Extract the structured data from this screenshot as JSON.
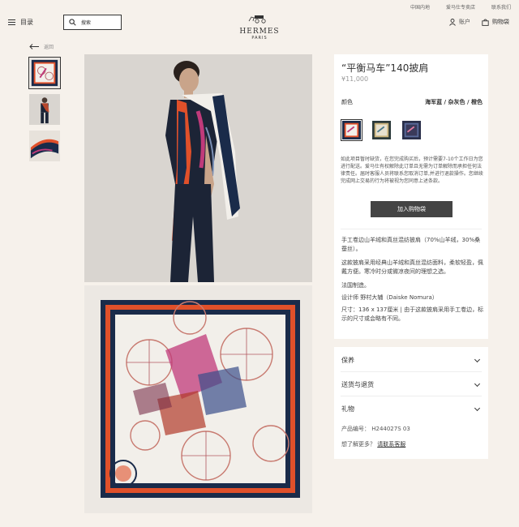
{
  "topbar": {
    "region": "中国内地",
    "service": "爱马仕专卖店",
    "contact": "联系我们"
  },
  "header": {
    "menu_label": "目录",
    "search_placeholder": "搜索",
    "logo_brand": "HERMES",
    "logo_city": "PARIS",
    "account_label": "账户",
    "bag_label": "购物袋"
  },
  "back_label": "返回",
  "product": {
    "title": "“平衡马车”140披肩",
    "price": "¥11,000",
    "color_label": "颜色",
    "color_value": "海军蓝 / 杂灰色 / 橙色",
    "notice": "如此项目暂时缺货，在您完成购买后，预计需要7-10个工作日为您进行配送。爱马仕有权解除此订单且无需为订单解除而承担任何法律责任。届时客服人员将联系您取消订单,并进行退款操作。您继续完成网上交易的行为将被视为您同意上述条款。",
    "add_to_bag": "加入购物袋",
    "desc": [
      "手工卷边山羊绒和真丝混纺披肩（70%山羊绒，30%桑蚕丝）。",
      "这款披肩采用经典山羊绒和真丝混纺面料，柔软轻盈，佩戴方便。寒冷时分或微凉夜间的理想之选。",
      "法国制造。",
      "设计师 野村大辅（Daiske Nomura）",
      "尺寸：136 x 137厘米 | 由于这款披肩采用手工卷边，标示的尺寸或会略有不同。"
    ]
  },
  "accordion": {
    "care": "保养",
    "shipping": "送货与退货",
    "gift": "礼物",
    "sku": "产品编号： H244027S 03",
    "more_prefix": "想了解更多？",
    "more_link": "请联系客服"
  },
  "colors": {
    "navy": "#1a2b4a",
    "orange": "#e0502a",
    "accent_dark": "#444444",
    "bg": "#f6f1eb"
  }
}
